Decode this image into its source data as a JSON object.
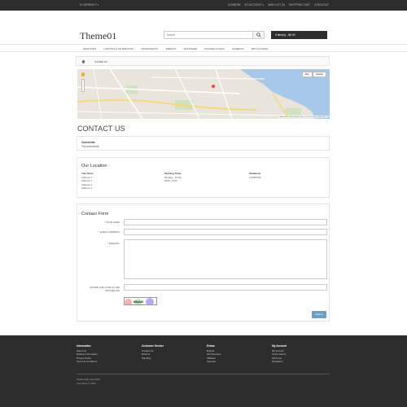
{
  "topbar": {
    "currency": "$ CURRENCY ▾",
    "links": [
      "123456789",
      "MY ACCOUNT ▾",
      "WISH LIST (0)",
      "SHOPPING CART",
      "CHECKOUT"
    ]
  },
  "header": {
    "logo": "Theme01",
    "search_placeholder": "Search",
    "cart_label": "0 item(s) - $0.00"
  },
  "nav": {
    "items": [
      "DESKTOPS",
      "LAPTOPS & NOTEBOOKS",
      "COMPONENTS",
      "TABLETS",
      "SOFTWARE",
      "PHONES & PDAS",
      "CAMERAS",
      "MP3 PLAYERS"
    ]
  },
  "breadcrumb": {
    "current": "Contact Us"
  },
  "map": {
    "buttons": [
      "Map",
      "Satellite"
    ],
    "footer": "Map data ©2015 Google   Terms of Use   Report a map error"
  },
  "page_title": "CONTACT US",
  "comments_box": {
    "label": "Comments",
    "value": "Test comments"
  },
  "location": {
    "heading": "Our Location",
    "store_label": "Your Store",
    "address_lines": [
      "Address 1",
      "Address 1",
      "Address 1",
      "Address 1"
    ],
    "hours_label": "Opening Times",
    "hours_lines": [
      "Monday - Friday",
      "0900 - 1700"
    ],
    "phone_label": "Telephone",
    "phone": "123456789"
  },
  "form": {
    "heading": "Contact Form",
    "name_label": "YOUR NAME",
    "email_label": "E-MAIL ADDRESS",
    "enquiry_label": "ENQUIRY",
    "captcha_label_1": "ENTER THE CODE IN THE",
    "captcha_label_2": "BOX BELOW",
    "captcha_code": "b9a2d3",
    "submit": "Submit"
  },
  "footer": {
    "information": {
      "heading": "Information",
      "items": [
        "About Us",
        "Delivery Information",
        "Privacy Policy",
        "Terms & Conditions"
      ]
    },
    "service": {
      "heading": "Customer Service",
      "items": [
        "Contact Us",
        "Returns",
        "Site Map"
      ]
    },
    "extras": {
      "heading": "Extras",
      "items": [
        "Brands",
        "Gift Vouchers",
        "Affiliates",
        "Specials"
      ]
    },
    "account": {
      "heading": "My Account",
      "items": [
        "My Account",
        "Order History",
        "Wish List",
        "Newsletter"
      ]
    },
    "powered": "Powered By OpenCart",
    "copyright": "Your Store © 2014"
  }
}
